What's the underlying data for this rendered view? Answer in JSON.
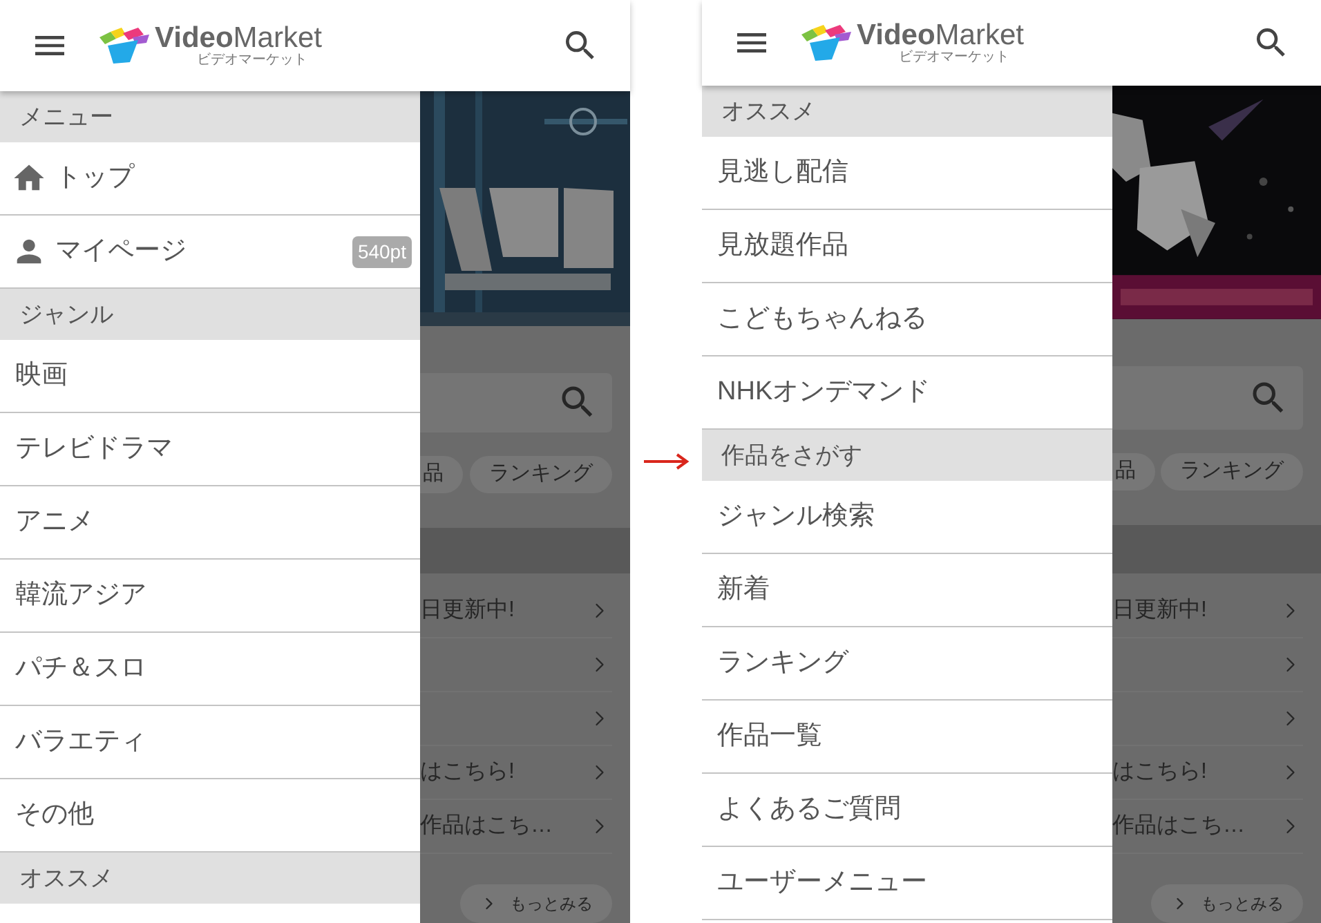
{
  "screens": [
    {
      "header": {
        "brand_bold": "Video",
        "brand_light": "Market",
        "brand_kana": "ビデオマーケット"
      },
      "drawer": [
        {
          "kind": "section",
          "label": "メニュー"
        },
        {
          "kind": "home",
          "label": "トップ"
        },
        {
          "kind": "account",
          "label": "マイページ",
          "badge": "540pt"
        },
        {
          "kind": "section",
          "label": "ジャンル"
        },
        {
          "kind": "link",
          "label": "映画"
        },
        {
          "kind": "link",
          "label": "テレビドラマ"
        },
        {
          "kind": "link",
          "label": "アニメ"
        },
        {
          "kind": "link",
          "label": "韓流アジア"
        },
        {
          "kind": "link",
          "label": "パチ＆スロ"
        },
        {
          "kind": "link",
          "label": "バラエティ"
        },
        {
          "kind": "link",
          "label": "その他"
        },
        {
          "kind": "section",
          "label": "オススメ"
        }
      ],
      "backdrop": {
        "tabs": [
          "品",
          "ランキング"
        ],
        "rows": [
          {
            "kind": "text",
            "text": "日更新中!"
          },
          {
            "kind": "blank"
          },
          {
            "kind": "blank"
          },
          {
            "kind": "text",
            "text": "はこちら!"
          },
          {
            "kind": "text",
            "text": "作品はこち…"
          }
        ],
        "more_button": "もっとみる"
      }
    },
    {
      "header": {
        "brand_bold": "Video",
        "brand_light": "Market",
        "brand_kana": "ビデオマーケット"
      },
      "drawer": [
        {
          "kind": "section",
          "label": "オススメ"
        },
        {
          "kind": "link",
          "label": "見逃し配信"
        },
        {
          "kind": "link",
          "label": "見放題作品"
        },
        {
          "kind": "link",
          "label": "こどもちゃんねる"
        },
        {
          "kind": "link",
          "label": "NHKオンデマンド"
        },
        {
          "kind": "section",
          "label": "作品をさがす"
        },
        {
          "kind": "link",
          "label": "ジャンル検索"
        },
        {
          "kind": "link",
          "label": "新着"
        },
        {
          "kind": "link",
          "label": "ランキング"
        },
        {
          "kind": "link",
          "label": "作品一覧"
        },
        {
          "kind": "link",
          "label": "よくあるご質問"
        },
        {
          "kind": "link",
          "label": "ユーザーメニュー"
        }
      ],
      "backdrop": {
        "tabs": [
          "品",
          "ランキング"
        ],
        "rows": [
          {
            "kind": "text",
            "text": "日更新中!"
          },
          {
            "kind": "blank"
          },
          {
            "kind": "blank"
          },
          {
            "kind": "text",
            "text": "はこちら!"
          },
          {
            "kind": "text",
            "text": "作品はこち…"
          }
        ],
        "more_button": "もっとみる"
      }
    }
  ]
}
